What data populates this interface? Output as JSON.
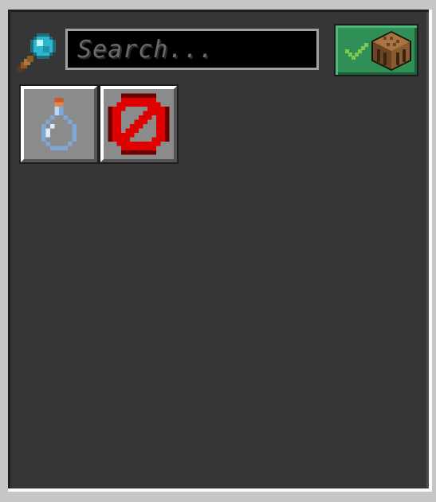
{
  "search": {
    "placeholder": "Search...",
    "value": ""
  },
  "icons": {
    "search": "magnifying-glass-icon",
    "craft_toggle_check": "checkmark-icon",
    "craft_toggle_table": "crafting-table-icon"
  },
  "toggle": {
    "state": "enabled",
    "color": "#2f8f57"
  },
  "slots": [
    {
      "item": "glass-bottle-icon"
    },
    {
      "item": "barrier-icon"
    }
  ],
  "colors": {
    "panel": "#363636",
    "frame": "#c6c6c6",
    "slot": "#8b8b8b",
    "barrier_red": "#e00000"
  }
}
